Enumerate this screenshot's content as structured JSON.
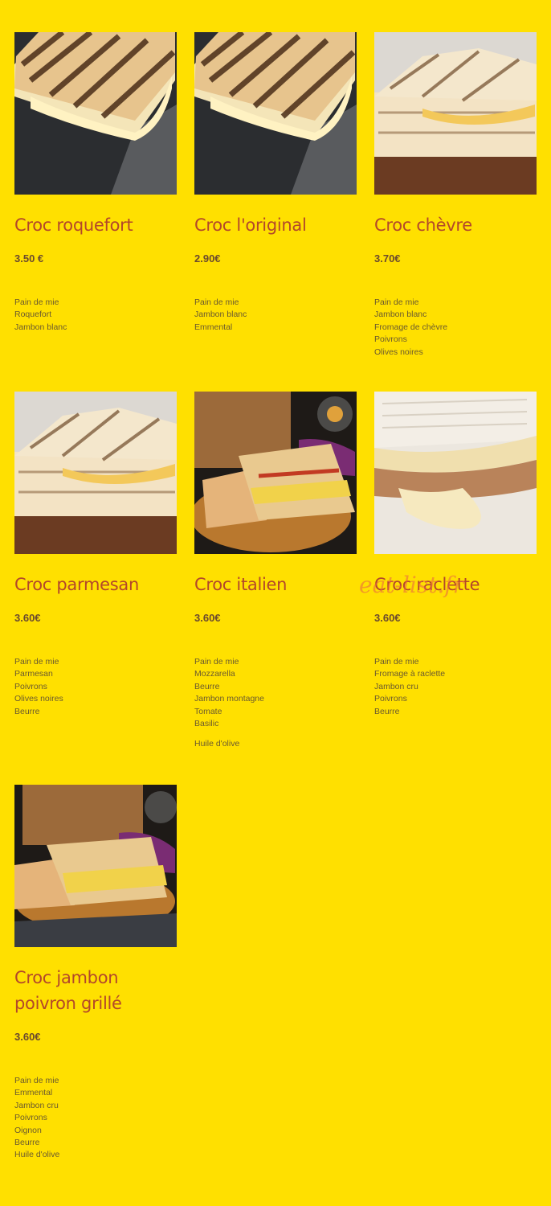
{
  "watermark": "eat-list.fr",
  "items": [
    {
      "title": "Croc roquefort",
      "price": "3.50 €",
      "ingredients": [
        "Pain de mie",
        "Roquefort",
        "Jambon blanc"
      ]
    },
    {
      "title": "Croc l'original",
      "price": "2.90€",
      "ingredients": [
        "Pain de mie",
        "Jambon blanc",
        "Emmental"
      ]
    },
    {
      "title": "Croc chèvre",
      "price": "3.70€",
      "ingredients": [
        "Pain de mie",
        "Jambon blanc",
        "Fromage de chèvre",
        "Poivrons",
        "Olives noires"
      ]
    },
    {
      "title": "Croc parmesan",
      "price": "3.60€",
      "ingredients": [
        "Pain de mie",
        "Parmesan",
        "Poivrons",
        "Olives noires",
        "Beurre"
      ]
    },
    {
      "title": "Croc italien",
      "price": "3.60€",
      "ingredients": [
        "Pain de mie",
        "Mozzarella",
        "Beurre",
        "Jambon montagne",
        "Tomate",
        "Basilic"
      ],
      "extra": "Huile d'olive"
    },
    {
      "title": "Croc raclette",
      "price": "3.60€",
      "ingredients": [
        "Pain de mie",
        "Fromage à raclette",
        "Jambon cru",
        "Poivrons",
        "Beurre"
      ]
    },
    {
      "title": "Croc jambon poivron grillé",
      "price": "3.60€",
      "ingredients": [
        "Pain de mie",
        "Emmental",
        "Jambon cru",
        "Poivrons",
        "Oignon",
        "Beurre",
        "Huile d'olive"
      ]
    }
  ]
}
